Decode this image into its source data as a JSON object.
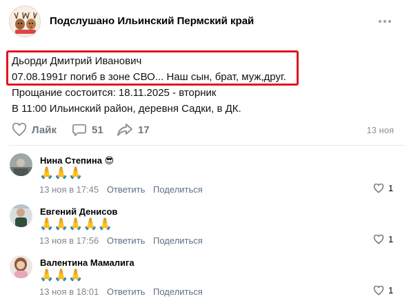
{
  "group": {
    "name": "Подслушано Ильинский Пермский край",
    "avatar_icon": "group-avatar-deer-icon",
    "menu_icon": "more-dots-icon"
  },
  "post": {
    "lines": [
      "Дьорди Дмитрий Иванович",
      "07.08.1991г погиб в зоне СВО... Наш сын, брат, муж,друг.",
      "Прощание состоится: 18.11.2025 - вторник",
      "В 11:00 Ильинский район, деревня Садки, в ДК."
    ],
    "highlight_color": "#e0141e"
  },
  "actions": {
    "like_label": "Лайк",
    "comments_count": "51",
    "shares_count": "17",
    "date": "13 ноя"
  },
  "comments": [
    {
      "author": "Нина Степина",
      "author_badge": "😎",
      "text": "🙏🙏🙏",
      "date": "13 ноя в 17:45",
      "reply_label": "Ответить",
      "share_label": "Поделиться",
      "likes": "1"
    },
    {
      "author": "Евгений Денисов",
      "author_badge": "",
      "text": "🙏🙏🙏🙏🙏",
      "date": "13 ноя в 17:56",
      "reply_label": "Ответить",
      "share_label": "Поделиться",
      "likes": "1"
    },
    {
      "author": "Валентина Мамалига",
      "author_badge": "",
      "text": "🙏🙏🙏",
      "date": "13 ноя в 18:01",
      "reply_label": "Ответить",
      "share_label": "Поделиться",
      "likes": "1"
    }
  ],
  "colors": {
    "accent_link": "#5c6f86",
    "muted": "#6f7780"
  }
}
